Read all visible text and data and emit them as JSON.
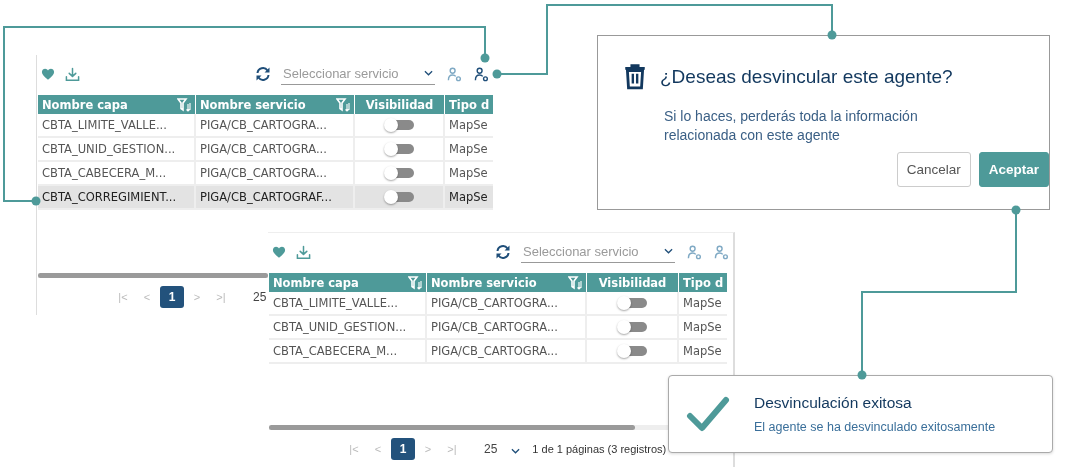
{
  "panels": [
    {
      "service_select": {
        "placeholder": "Seleccionar servicio"
      },
      "agent_buttons": [
        {
          "selected": false
        },
        {
          "selected": true
        }
      ],
      "columns": [
        {
          "label": "Nombre capa",
          "filter": true
        },
        {
          "label": "Nombre servicio",
          "filter": true
        },
        {
          "label": "Visibilidad",
          "filter": false
        },
        {
          "label": "Tipo d",
          "filter": false
        }
      ],
      "rows": [
        {
          "selected": false,
          "layer": "CBTA_LIMITE_VALLE...",
          "service": "PIGA/CB_CARTOGRA...",
          "visible": false,
          "type": "MapSe"
        },
        {
          "selected": false,
          "layer": "CBTA_UNID_GESTION...",
          "service": "PIGA/CB_CARTOGRA...",
          "visible": false,
          "type": "MapSe"
        },
        {
          "selected": false,
          "layer": "CBTA_CABECERA_M...",
          "service": "PIGA/CB_CARTOGRA...",
          "visible": false,
          "type": "MapSe"
        },
        {
          "selected": true,
          "layer": "CBTA_CORREGIMIENT...",
          "service": "PIGA/CB_CARTOGRAF...",
          "visible": false,
          "type": "MapSe"
        }
      ],
      "pagination": {
        "first": "|<",
        "prev": "<",
        "pages": [
          {
            "label": "1",
            "selected": true
          }
        ],
        "next": ">",
        "last": ">|",
        "page_size": "25"
      }
    },
    {
      "service_select": {
        "placeholder": "Seleccionar servicio"
      },
      "agent_buttons": [
        {
          "selected": false
        },
        {
          "selected": false
        }
      ],
      "columns": [
        {
          "label": "Nombre capa",
          "filter": true
        },
        {
          "label": "Nombre servicio",
          "filter": true
        },
        {
          "label": "Visibilidad",
          "filter": false
        },
        {
          "label": "Tipo d",
          "filter": false
        }
      ],
      "rows": [
        {
          "selected": false,
          "layer": "CBTA_LIMITE_VALLE...",
          "service": "PIGA/CB_CARTOGRA...",
          "visible": false,
          "type": "MapSe"
        },
        {
          "selected": false,
          "layer": "CBTA_UNID_GESTION...",
          "service": "PIGA/CB_CARTOGRA...",
          "visible": false,
          "type": "MapSe"
        },
        {
          "selected": false,
          "layer": "CBTA_CABECERA_M...",
          "service": "PIGA/CB_CARTOGRA...",
          "visible": false,
          "type": "MapSe"
        }
      ],
      "pagination": {
        "first": "|<",
        "prev": "<",
        "pages": [
          {
            "label": "1",
            "selected": true
          }
        ],
        "next": ">",
        "last": ">|",
        "page_size": "25",
        "summary": "1 de 1 páginas (3 registros)"
      }
    }
  ],
  "dialog": {
    "title": "¿Deseas desvincular este agente?",
    "message": "Si lo haces, perderás toda la información relacionada con este agente",
    "buttons": [
      {
        "label": "Cancelar",
        "kind": "secondary"
      },
      {
        "label": "Aceptar",
        "kind": "primary"
      }
    ]
  },
  "toast": {
    "title": "Desvinculación exitosa",
    "message": "El agente se ha desvinculado exitosamente"
  }
}
